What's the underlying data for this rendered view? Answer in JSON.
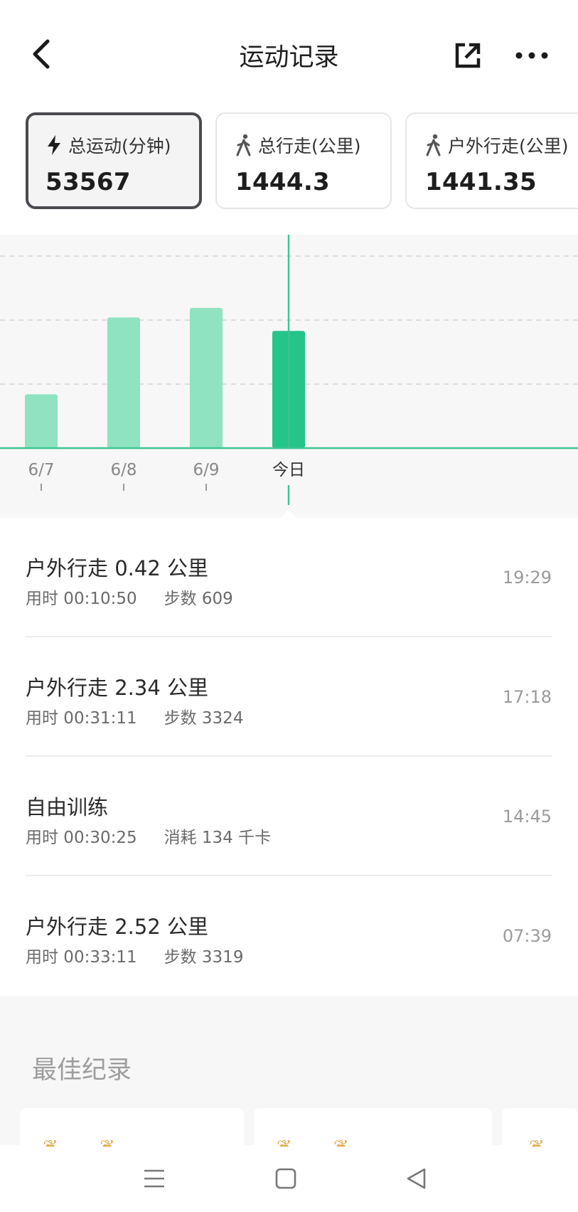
{
  "header": {
    "title": "运动记录"
  },
  "cards": [
    {
      "label": "总运动(分钟)",
      "value": "53567",
      "icon": "lightning-icon",
      "active": true
    },
    {
      "label": "总行走(公里)",
      "value": "1444.3",
      "icon": "walk-icon",
      "active": false
    },
    {
      "label": "户外行走(公里)",
      "value": "1441.35",
      "icon": "walk-icon",
      "active": false
    }
  ],
  "chart_data": {
    "type": "bar",
    "categories": [
      "6/7",
      "6/8",
      "6/9",
      "今日"
    ],
    "values": [
      28,
      68,
      73,
      61
    ],
    "highlight": "今日",
    "colors": {
      "bar": "#8fe3c1",
      "highlight": "#25c489",
      "axis": "#3cc591"
    }
  },
  "records": [
    {
      "title": "户外行走 0.42 公里",
      "duration": "用时 00:10:50",
      "extra": "步数 609",
      "time": "19:29"
    },
    {
      "title": "户外行走 2.34 公里",
      "duration": "用时 00:31:11",
      "extra": "步数 3324",
      "time": "17:18"
    },
    {
      "title": "自由训练",
      "duration": "用时 00:30:25",
      "extra": "消耗 134 千卡",
      "time": "14:45"
    },
    {
      "title": "户外行走 2.52 公里",
      "duration": "用时 00:33:11",
      "extra": "步数 3319",
      "time": "07:39"
    }
  ],
  "best": {
    "title": "最佳纪录"
  },
  "nav": {
    "icons": [
      "menu-icon",
      "home-icon",
      "back-triangle-icon"
    ]
  }
}
